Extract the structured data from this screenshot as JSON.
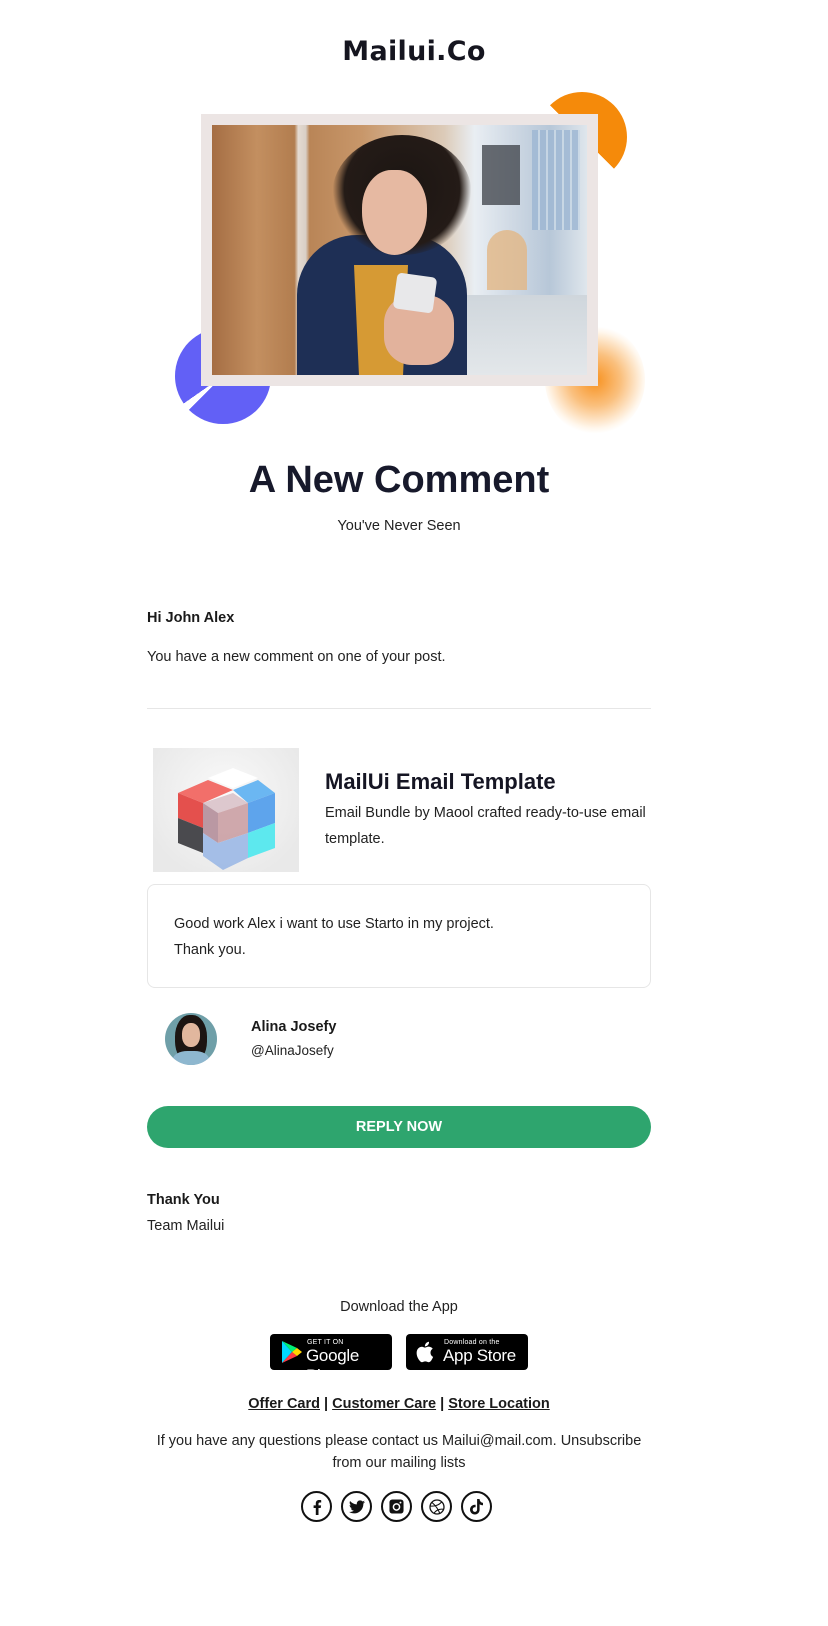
{
  "header": {
    "logo": "Mailui.Co"
  },
  "hero": {
    "image_alt": "Woman smiling while using smartphone",
    "accent_colors": {
      "orange": "#f58a0a",
      "blue": "#6260f6"
    }
  },
  "headline": {
    "title": "A New Comment",
    "subtitle": "You've Never Seen"
  },
  "message": {
    "greeting": "Hi John Alex",
    "intro": "You have a new comment on one of your post."
  },
  "product": {
    "image_alt": "Colorful glass cubes",
    "title": "MailUi Email Template",
    "description": "Email Bundle by Maool crafted ready-to-use email template."
  },
  "comment": {
    "line1": "Good work Alex i want to use Starto in my project.",
    "line2": "Thank you."
  },
  "author": {
    "name": "Alina Josefy",
    "handle": "@AlinaJosefy"
  },
  "cta": {
    "label": "REPLY NOW",
    "color": "#2ea56e"
  },
  "signoff": {
    "thanks": "Thank You",
    "team": "Team Mailui"
  },
  "footer": {
    "download_label": "Download the App",
    "google_play": {
      "small": "GET IT ON",
      "big": "Google Play"
    },
    "app_store": {
      "small": "Download on the",
      "big": "App Store"
    },
    "links": [
      {
        "label": "Offer Card"
      },
      {
        "label": "Customer Care"
      },
      {
        "label": "Store Location"
      }
    ],
    "separator": "|",
    "contact_text": "If you have any questions please contact us Mailui@mail.com. Unsubscribe from our mailing lists",
    "socials": [
      {
        "name": "facebook",
        "icon": "facebook-icon"
      },
      {
        "name": "twitter",
        "icon": "twitter-icon"
      },
      {
        "name": "instagram",
        "icon": "instagram-icon"
      },
      {
        "name": "dribbble",
        "icon": "dribbble-icon"
      },
      {
        "name": "tiktok",
        "icon": "tiktok-icon"
      }
    ]
  }
}
